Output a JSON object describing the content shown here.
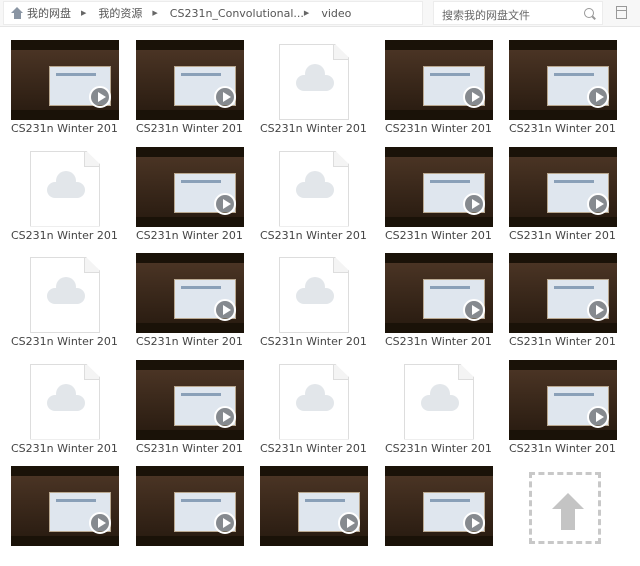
{
  "breadcrumb": {
    "items": [
      "我的网盘",
      "我的资源",
      "CS231n_Convolutional...",
      "video"
    ]
  },
  "search": {
    "placeholder": "搜索我的网盘文件"
  },
  "files": [
    {
      "type": "video",
      "label": "CS231n Winter 201..."
    },
    {
      "type": "video",
      "label": "CS231n Winter 201..."
    },
    {
      "type": "file",
      "label": "CS231n Winter 201..."
    },
    {
      "type": "video",
      "label": "CS231n Winter 201..."
    },
    {
      "type": "video",
      "label": "CS231n Winter 201..."
    },
    {
      "type": "file",
      "label": "CS231n Winter 201..."
    },
    {
      "type": "video",
      "label": "CS231n Winter 201..."
    },
    {
      "type": "file",
      "label": "CS231n Winter 201..."
    },
    {
      "type": "video",
      "label": "CS231n Winter 201..."
    },
    {
      "type": "video",
      "label": "CS231n Winter 201..."
    },
    {
      "type": "file",
      "label": "CS231n Winter 201..."
    },
    {
      "type": "video",
      "label": "CS231n Winter 201..."
    },
    {
      "type": "file",
      "label": "CS231n Winter 201..."
    },
    {
      "type": "video",
      "label": "CS231n Winter 201..."
    },
    {
      "type": "video",
      "label": "CS231n Winter 201..."
    },
    {
      "type": "file",
      "label": "CS231n Winter 201..."
    },
    {
      "type": "video",
      "label": "CS231n Winter 201..."
    },
    {
      "type": "file",
      "label": "CS231n Winter 201..."
    },
    {
      "type": "file",
      "label": "CS231n Winter 201..."
    },
    {
      "type": "video",
      "label": "CS231n Winter 201..."
    },
    {
      "type": "video",
      "label": ""
    },
    {
      "type": "video",
      "label": ""
    },
    {
      "type": "video",
      "label": ""
    },
    {
      "type": "video",
      "label": ""
    },
    {
      "type": "upload",
      "label": ""
    }
  ]
}
